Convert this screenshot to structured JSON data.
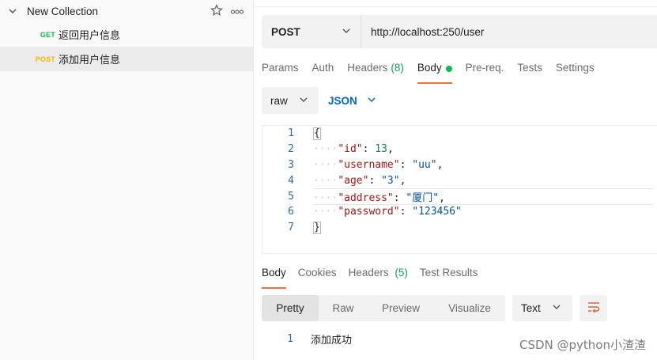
{
  "sidebar": {
    "collection_name": "New Collection",
    "requests": [
      {
        "method": "GET",
        "method_color": "#0cbb52",
        "name": "返回用户信息"
      },
      {
        "method": "POST",
        "method_color": "#ffb400",
        "name": "添加用户信息"
      }
    ]
  },
  "request": {
    "method": "POST",
    "url": "http://localhost:250/user",
    "tabs": {
      "params": "Params",
      "auth": "Auth",
      "headers": "Headers",
      "headers_count": "(8)",
      "body": "Body",
      "prereq": "Pre-req.",
      "tests": "Tests",
      "settings": "Settings"
    },
    "body_mode": "raw",
    "body_format": "JSON",
    "body_lines": [
      {
        "n": "1",
        "text": "{"
      },
      {
        "n": "2",
        "key": "\"id\"",
        "value": "13",
        "vtype": "num",
        "comma": ","
      },
      {
        "n": "3",
        "key": "\"username\"",
        "value": "\"uu\"",
        "vtype": "str",
        "comma": ","
      },
      {
        "n": "4",
        "key": "\"age\"",
        "value": "\"3\"",
        "vtype": "str",
        "comma": ","
      },
      {
        "n": "5",
        "key": "\"address\"",
        "value": "\"厦门\"",
        "vtype": "str",
        "comma": ","
      },
      {
        "n": "6",
        "key": "\"password\"",
        "value": "\"123456\"",
        "vtype": "str",
        "comma": ""
      },
      {
        "n": "7",
        "text": "}"
      }
    ]
  },
  "response": {
    "tabs": {
      "body": "Body",
      "cookies": "Cookies",
      "headers": "Headers",
      "headers_count": "(5)",
      "test_results": "Test Results"
    },
    "view_modes": [
      "Pretty",
      "Raw",
      "Preview",
      "Visualize"
    ],
    "selected_view": "Pretty",
    "format": "Text",
    "line_number": "1",
    "body_text": "添加成功"
  },
  "watermark": "CSDN @python小渣渣",
  "colors": {
    "accent": "#ff6c37",
    "json_link": "#0265d2",
    "body_dot": "#0cbb52",
    "headers_count": "#0f9d58"
  }
}
